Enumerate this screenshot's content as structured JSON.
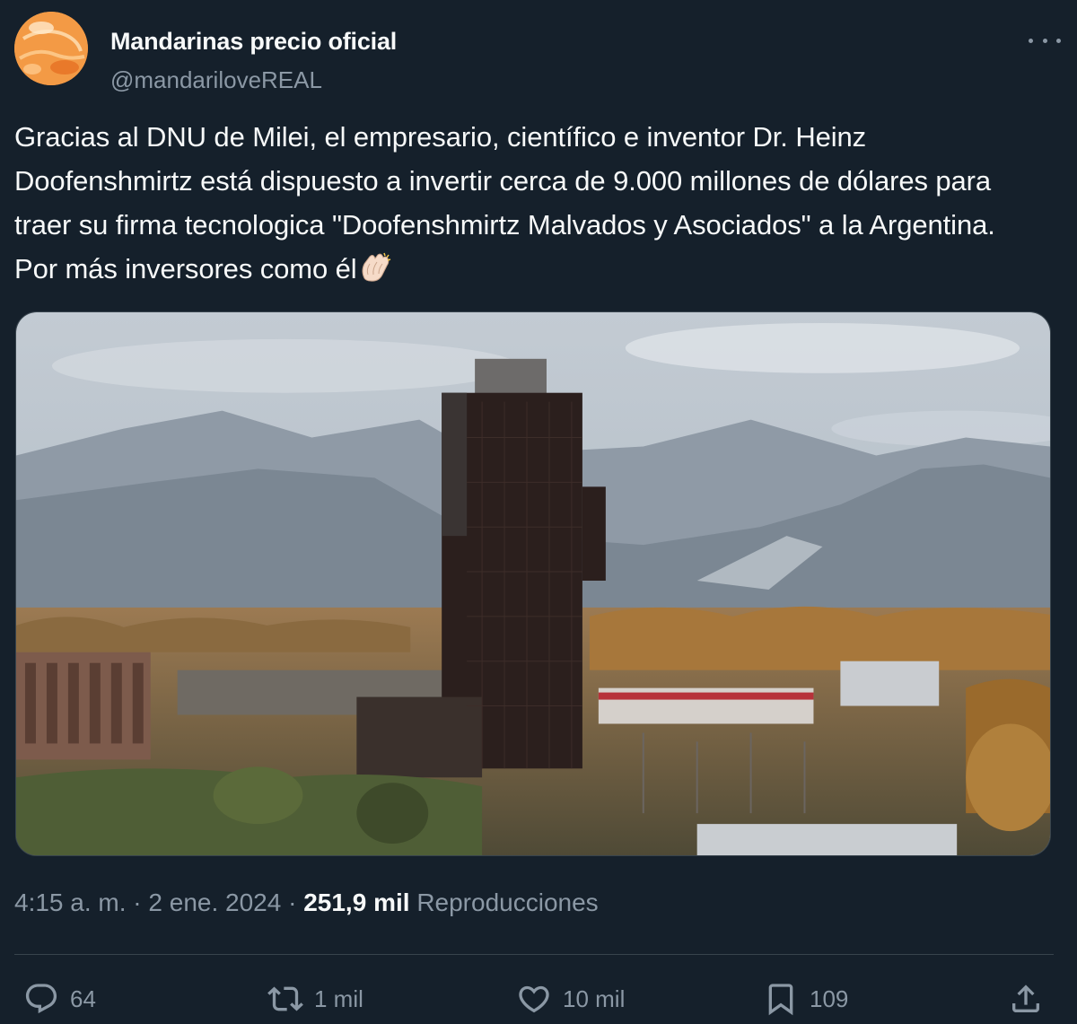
{
  "author": {
    "display_name": "Mandarinas precio oficial",
    "handle": "@mandariloveREAL",
    "avatar_icon": "mandarin-avatar"
  },
  "tweet": {
    "text": "Gracias al DNU de Milei, el empresario, científico e inventor Dr. Heinz Doofenshmirtz está dispuesto a invertir cerca de 9.000 millones de dólares para traer su firma tecnologica \"Doofenshmirtz Malvados y Asociados\" a la Argentina. Por más inversores como él",
    "emoji": "clapping-hands-icon"
  },
  "meta": {
    "time": "4:15 a. m.",
    "sep1": " · ",
    "date": "2 ene. 2024",
    "sep2": " · ",
    "views": "251,9 mil",
    "views_label": "Reproducciones"
  },
  "actions": {
    "replies": "64",
    "reposts": "1 mil",
    "likes": "10 mil",
    "bookmarks": "109"
  },
  "colors": {
    "background": "#15202b",
    "text": "#f7f9f9",
    "secondary": "#8b98a5",
    "border": "#38444d"
  }
}
